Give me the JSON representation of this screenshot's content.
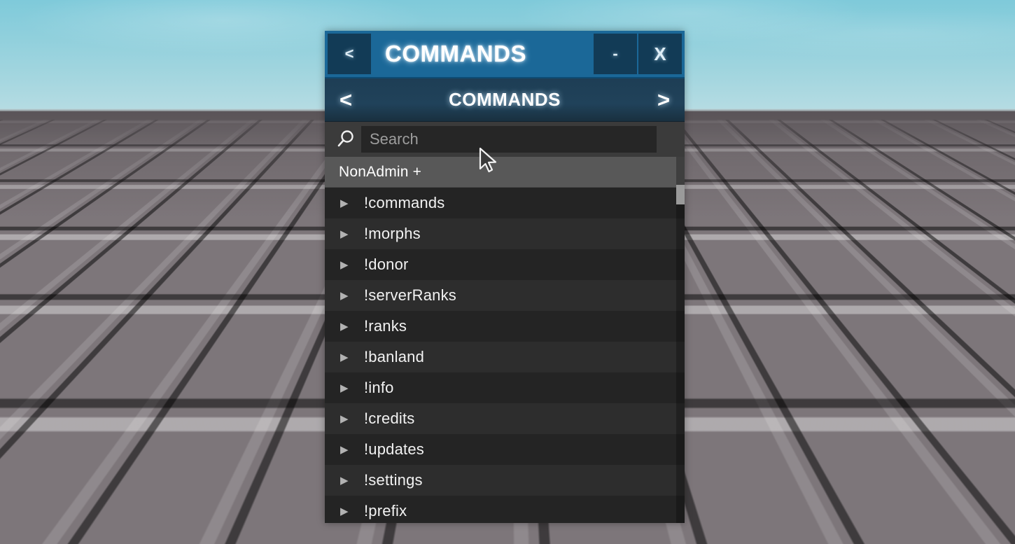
{
  "scene": {
    "environment": "roblox-baseplate",
    "sky_color": "#8ecfdc",
    "ground_color": "#6a6367"
  },
  "panel": {
    "titlebar": {
      "back_label": "<",
      "title": "COMMANDS",
      "minimize_label": "-",
      "close_label": "X",
      "background": "#1b6898"
    },
    "navbar": {
      "prev_label": "<",
      "title": "COMMANDS",
      "next_label": ">",
      "background": "#1e3e55"
    },
    "search": {
      "icon": "search-icon",
      "placeholder": "Search",
      "value": "",
      "field_background": "#262626"
    },
    "group": {
      "label": "NonAdmin +",
      "background": "#585858"
    },
    "commands": [
      {
        "arrow": "▶",
        "label": "!commands"
      },
      {
        "arrow": "▶",
        "label": "!morphs"
      },
      {
        "arrow": "▶",
        "label": "!donor"
      },
      {
        "arrow": "▶",
        "label": "!serverRanks"
      },
      {
        "arrow": "▶",
        "label": "!ranks"
      },
      {
        "arrow": "▶",
        "label": "!banland"
      },
      {
        "arrow": "▶",
        "label": "!info"
      },
      {
        "arrow": "▶",
        "label": "!credits"
      },
      {
        "arrow": "▶",
        "label": "!updates"
      },
      {
        "arrow": "▶",
        "label": "!settings"
      },
      {
        "arrow": "▶",
        "label": "!prefix"
      }
    ],
    "scrollbar": {
      "thumb_color": "#9a9a9a",
      "thumb_position_percent": 8
    }
  }
}
